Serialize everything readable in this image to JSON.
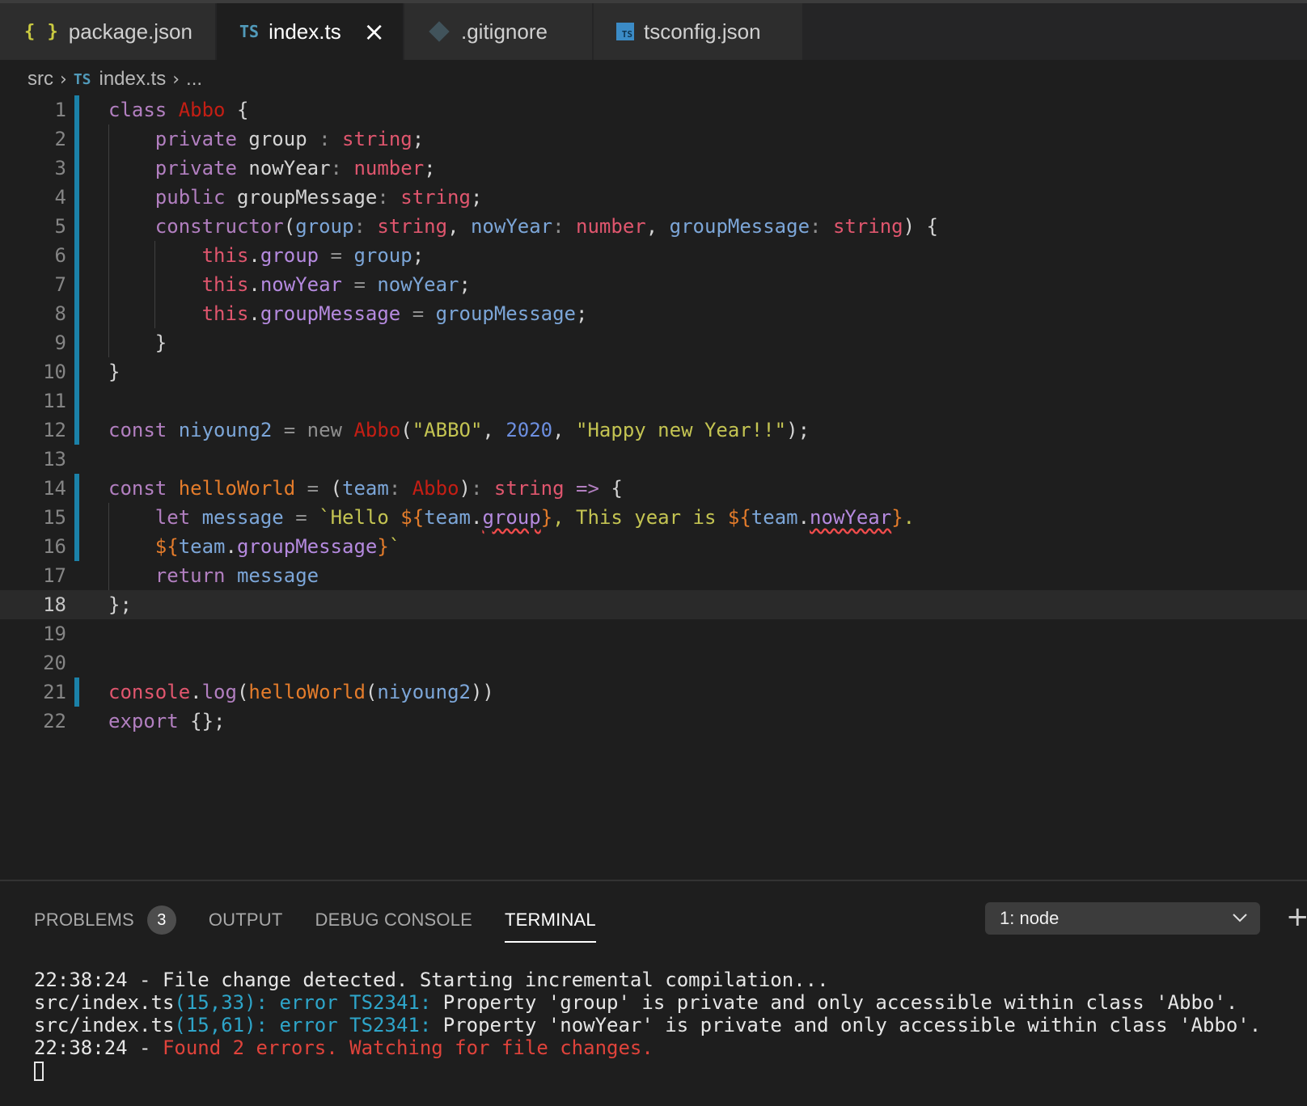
{
  "tabs": [
    {
      "label": "package.json",
      "icon": "json-braces-icon",
      "glyph": "{ }"
    },
    {
      "label": "index.ts",
      "icon": "typescript-icon",
      "glyph": "TS",
      "close": "×"
    },
    {
      "label": ".gitignore",
      "icon": "git-icon"
    },
    {
      "label": "tsconfig.json",
      "icon": "tsconfig-icon",
      "glyph": "TS"
    }
  ],
  "breadcrumb": {
    "folder": "src",
    "file_glyph": "TS",
    "file": "index.ts",
    "more": "..."
  },
  "code": {
    "lines": [
      "class Abbo {",
      "    private group : string;",
      "    private nowYear: number;",
      "    public groupMessage: string;",
      "    constructor(group: string, nowYear: number, groupMessage: string) {",
      "        this.group = group;",
      "        this.nowYear = nowYear;",
      "        this.groupMessage = groupMessage;",
      "    }",
      "}",
      "",
      "const niyoung2 = new Abbo(\"ABBO\", 2020, \"Happy new Year!!\");",
      "",
      "const helloWorld = (team: Abbo): string => {",
      "    let message = `Hello ${team.group}, This year is ${team.nowYear}.",
      "    ${team.groupMessage}`",
      "    return message",
      "};",
      "",
      "",
      "console.log(helloWorld(niyoung2))",
      "export {};"
    ]
  },
  "panel": {
    "tabs": [
      "PROBLEMS",
      "OUTPUT",
      "DEBUG CONSOLE",
      "TERMINAL"
    ],
    "problems_count": "3",
    "active_tab": "TERMINAL",
    "terminal_select": "1: node",
    "add_label": "+"
  },
  "terminal": {
    "line1": "22:38:24 - File change detected. Starting incremental compilation...",
    "line2": {
      "file": "src/index.ts",
      "loc": "(15,33):",
      "err": "error",
      "code": "TS2341:",
      "msg": "Property 'group' is private and only accessible within class 'Abbo'."
    },
    "line3": {
      "file": "src/index.ts",
      "loc": "(15,61):",
      "err": "error",
      "code": "TS2341:",
      "msg": "Property 'nowYear' is private and only accessible within class 'Abbo'."
    },
    "line4": {
      "time": "22:38:24 - ",
      "msg": "Found 2 errors. Watching for file changes."
    }
  },
  "colors": {
    "background": "#1e1e1e",
    "gutter_modified": "#1b81a8",
    "accent_ts": "#519aba",
    "error_red": "#e0433b"
  }
}
